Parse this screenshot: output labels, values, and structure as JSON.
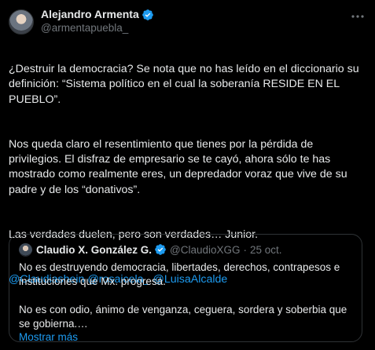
{
  "author": {
    "display_name": "Alejandro Armenta",
    "handle": "@armentapuebla_"
  },
  "tweet": {
    "paragraphs": [
      "¿Destruir la democracia? Se nota que no has leído en el diccionario su definición: “Sistema político en el cual la soberanía RESIDE EN EL PUEBLO”.",
      "Nos queda claro el resentimiento que tienes por la pérdida de privilegios. El disfraz de empresario se te cayó, ahora sólo te has mostrado como realmente eres, un depredador voraz que vive de su padre y de los “donativos”.",
      "Las verdades duelen, pero son verdades… Junior."
    ],
    "mentions": [
      "@Claudiashein",
      "@rosaicela_",
      "@LuisaAlcalde"
    ]
  },
  "quoted": {
    "display_name": "Claudio X. González G.",
    "handle": "@ClaudioXGG",
    "time": "25 oct.",
    "paragraphs": [
      "No es destruyendo democracia, libertades, derechos, contrapesos e instituciones que Mx. progresa.",
      "No es con odio, ánimo de venganza, ceguera, sordera y soberbia que se gobierna.…"
    ],
    "show_more": "Mostrar más"
  },
  "colors": {
    "background": "#000000",
    "text": "#e7e9ea",
    "secondary": "#71767b",
    "link": "#1d9bf0",
    "border": "#2f3336",
    "verified": "#1d9bf0",
    "affiliate_gold": "#e2b719"
  },
  "icons": {
    "verified": "verified-badge-icon",
    "more": "more-options-icon"
  }
}
